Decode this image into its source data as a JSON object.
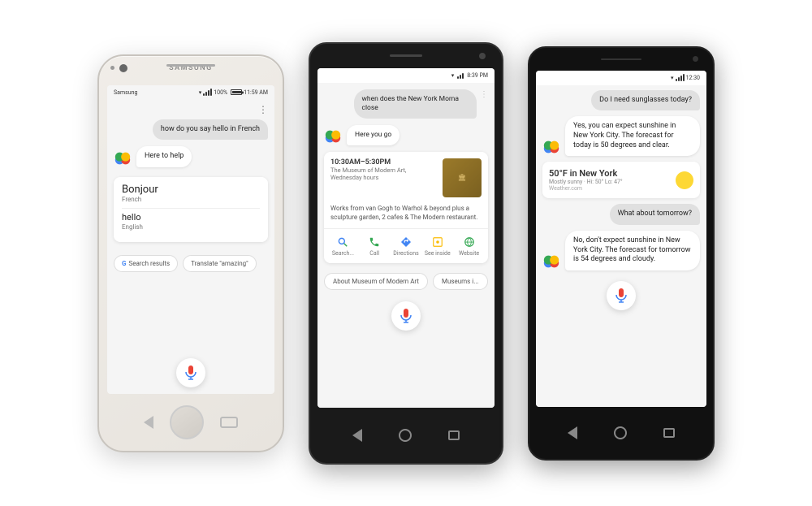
{
  "phone1": {
    "brand": "SAMSUNG",
    "carrier": "Samsung",
    "time": "11:59 AM",
    "battery": "100%",
    "user_message": "how do you say hello in French",
    "assistant_message": "Here to help",
    "translation1_word": "Bonjour",
    "translation1_lang": "French",
    "translation2_word": "hello",
    "translation2_lang": "English",
    "btn_search": "Search results",
    "btn_translate": "Translate \"amazing\""
  },
  "phone2": {
    "time": "8:39 PM",
    "user_message": "when does the New York Moma close",
    "assistant_message": "Here you go",
    "hours": "10:30AM–5:30PM",
    "venue": "The Museum of Modern Art, Wednesday hours",
    "description": "Works from van Gogh to Warhol & beyond plus a sculpture garden, 2 cafes & The Modern restaurant.",
    "action_search": "Search...",
    "action_call": "Call",
    "action_directions": "Directions",
    "action_inside": "See inside",
    "action_website": "Website",
    "suggest1": "About Museum of Modern Art",
    "suggest2": "Museums i..."
  },
  "phone3": {
    "time": "12:30",
    "user_message1": "Do I need sunglasses today?",
    "assistant_message1": "Yes, you can expect sunshine in New York City. The forecast for today is 50 degrees and clear.",
    "weather_temp": "50°F in New York",
    "weather_sub": "Mostly sunny · Hi: 50° Lo: 47°",
    "weather_source": "Weather.com",
    "user_message2": "What about tomorrow?",
    "assistant_message2": "No, don't expect sunshine in New York City. The forecast for tomorrow is 54 degrees and cloudy."
  }
}
